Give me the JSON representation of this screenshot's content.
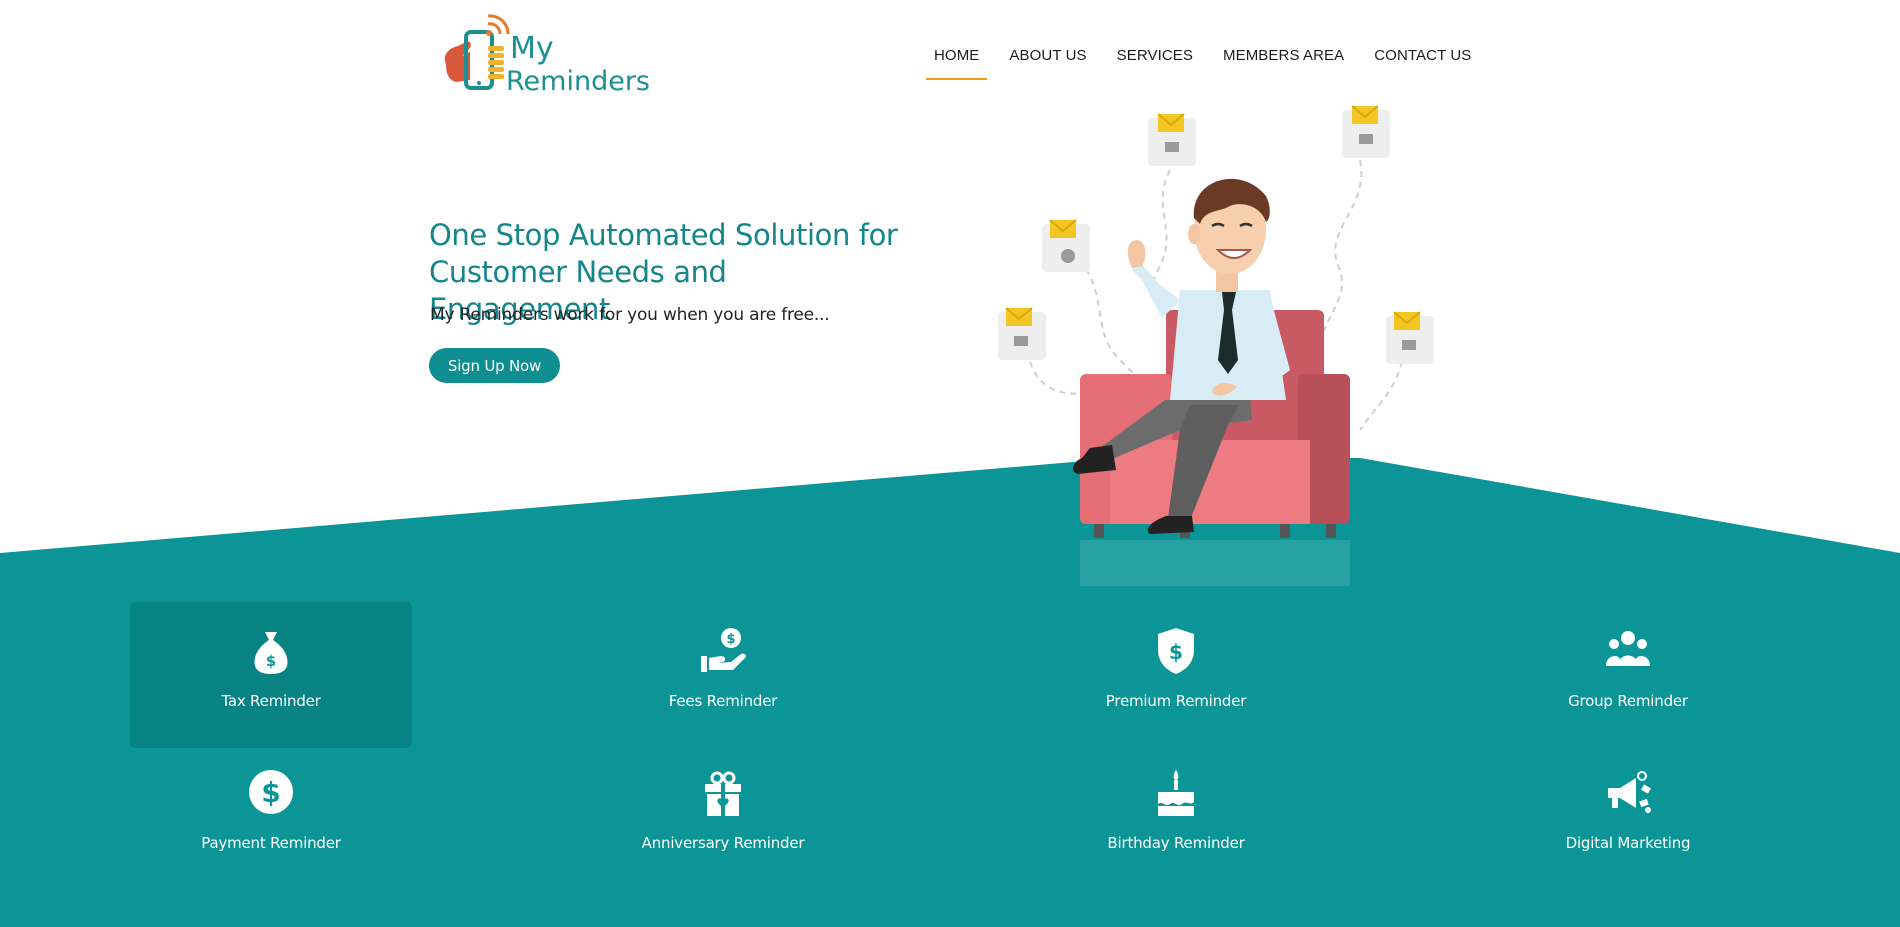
{
  "brand": {
    "logo_line1": "My",
    "logo_line2": "Reminders"
  },
  "nav": {
    "items": [
      {
        "label": "HOME",
        "active": true
      },
      {
        "label": "ABOUT US",
        "active": false
      },
      {
        "label": "SERVICES",
        "active": false
      },
      {
        "label": "MEMBERS AREA",
        "active": false
      },
      {
        "label": "CONTACT US",
        "active": false
      }
    ]
  },
  "hero": {
    "title_line1": "One Stop Automated Solution for",
    "title_line2": "Customer Needs and Engagement",
    "subtitle": "My Reminders work for you when you are free...",
    "cta_label": "Sign Up Now"
  },
  "services": [
    {
      "label": "Tax Reminder",
      "icon": "money-bag-icon",
      "highlighted": true
    },
    {
      "label": "Fees Reminder",
      "icon": "hand-coin-icon",
      "highlighted": false
    },
    {
      "label": "Premium Reminder",
      "icon": "shield-dollar-icon",
      "highlighted": false
    },
    {
      "label": "Group Reminder",
      "icon": "group-icon",
      "highlighted": false
    },
    {
      "label": "Payment Reminder",
      "icon": "dollar-circle-icon",
      "highlighted": false
    },
    {
      "label": "Anniversary Reminder",
      "icon": "gift-icon",
      "highlighted": false
    },
    {
      "label": "Birthday Reminder",
      "icon": "birthday-cake-icon",
      "highlighted": false
    },
    {
      "label": "Digital Marketing",
      "icon": "megaphone-icon",
      "highlighted": false
    }
  ],
  "colors": {
    "teal": "#0b9596",
    "teal_dark": "#088384",
    "accent_orange": "#f29a1b",
    "title_teal": "#14868b"
  }
}
